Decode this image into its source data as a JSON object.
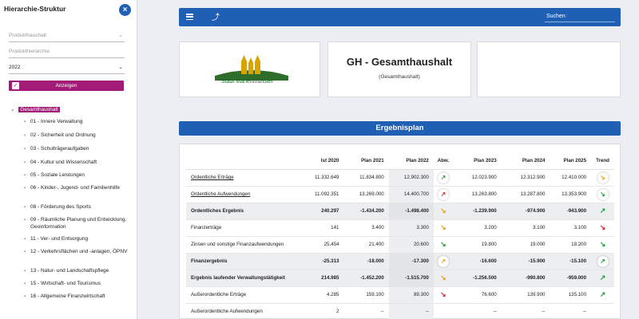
{
  "sidebar": {
    "title": "Hierarchie-Struktur",
    "close_icon": "×",
    "field1_placeholder": "Produkthaushalt",
    "field2_placeholder": "Produkthierarchie",
    "year": "2022",
    "button_label": "Anzeigen",
    "root_label": "Gesamthaushalt",
    "items": [
      {
        "label": "01 - Innere Verwaltung"
      },
      {
        "label": "02 - Sicherheit und Ordnung"
      },
      {
        "label": "03 - Schulträgeraufgaben"
      },
      {
        "label": "04 - Kultur und Wissenschaft"
      },
      {
        "label": "05 - Soziale Leistungen"
      },
      {
        "label": "06 - Kinder-, Jugend- und Familienhilfe"
      },
      {
        "label": "08 - Förderung des Sports"
      },
      {
        "label": "09 - Räumliche Planung und Entwicklung, Geoinformation"
      },
      {
        "label": "11 - Ver- und Entsorgung"
      },
      {
        "label": "12 - Verkehrsflächen und -anlagen, ÖPNV"
      },
      {
        "label": "13 - Natur- und Landschaftspflege"
      },
      {
        "label": "15 - Wirtschaft- und Tourismus"
      },
      {
        "label": "16 - Allgemeine Finanzwirtschaft"
      }
    ]
  },
  "topbar": {
    "search_label": "Suchen",
    "up_icon": "⤴"
  },
  "cards": {
    "logo_text": "Stadt Marienmünster",
    "title": "GH - Gesamthaushalt",
    "subtitle": "(Gesamthaushalt)"
  },
  "plan": {
    "header": "Ergebnisplan",
    "columns": [
      "",
      "Ist 2020",
      "Plan 2021",
      "Plan 2022",
      "Abw.",
      "Plan 2023",
      "Plan 2024",
      "Plan 2025",
      "Trend"
    ],
    "rows": [
      {
        "label": "Ordentliche Erträge",
        "ist2020": "11.332.649",
        "p2021": "11.834.800",
        "p2022": "12.902.300",
        "abw": "↗",
        "abw_color": "green",
        "abw_circle": true,
        "p2023": "12.023.900",
        "p2024": "12.312.900",
        "p2025": "12.410.000",
        "trend": "↘",
        "trend_color": "orange",
        "trend_circle": true,
        "underline": true,
        "shaded": false
      },
      {
        "label": "Ordentliche Aufwendungen",
        "ist2020": "11.092.351",
        "p2021": "13.269.000",
        "p2022": "14.400.700",
        "abw": "↗",
        "abw_color": "red",
        "abw_circle": true,
        "p2023": "13.263.800",
        "p2024": "13.287.800",
        "p2025": "13.353.900",
        "trend": "↘",
        "trend_color": "green",
        "trend_circle": true,
        "underline": true,
        "shaded": false
      },
      {
        "label": "Ordentliches Ergebnis",
        "ist2020": "240.297",
        "p2021": "-1.434.200",
        "p2022": "-1.498.400",
        "abw": "↘",
        "abw_color": "orange",
        "abw_circle": false,
        "p2023": "-1.239.900",
        "p2024": "-974.900",
        "p2025": "-943.900",
        "trend": "↗",
        "trend_color": "green",
        "trend_circle": false,
        "underline": false,
        "shaded": true
      },
      {
        "label": "Finanzerträge",
        "ist2020": "141",
        "p2021": "3.400",
        "p2022": "3.300",
        "abw": "↘",
        "abw_color": "orange",
        "abw_circle": false,
        "p2023": "3.200",
        "p2024": "3.100",
        "p2025": "3.100",
        "trend": "↘",
        "trend_color": "red",
        "trend_circle": false,
        "underline": false,
        "shaded": false
      },
      {
        "label": "Zinsen und sonstige Finanzaufwendungen",
        "ist2020": "25.454",
        "p2021": "21.400",
        "p2022": "20.600",
        "abw": "↘",
        "abw_color": "green",
        "abw_circle": false,
        "p2023": "19.800",
        "p2024": "19.000",
        "p2025": "18.200",
        "trend": "↘",
        "trend_color": "green",
        "trend_circle": false,
        "underline": false,
        "shaded": false
      },
      {
        "label": "Finanzergebnis",
        "ist2020": "-25.313",
        "p2021": "-18.000",
        "p2022": "-17.300",
        "abw": "↗",
        "abw_color": "orange",
        "abw_circle": true,
        "p2023": "-16.600",
        "p2024": "-15.900",
        "p2025": "-15.100",
        "trend": "↗",
        "trend_color": "green",
        "trend_circle": true,
        "underline": false,
        "shaded": true
      },
      {
        "label": "Ergebnis laufender Verwaltungstätigkeit",
        "ist2020": "214.985",
        "p2021": "-1.452.200",
        "p2022": "-1.515.700",
        "abw": "↘",
        "abw_color": "orange",
        "abw_circle": false,
        "p2023": "-1.256.500",
        "p2024": "-990.800",
        "p2025": "-959.000",
        "trend": "↗",
        "trend_color": "green",
        "trend_circle": false,
        "underline": false,
        "shaded": true
      },
      {
        "label": "Außerordentliche Erträge",
        "ist2020": "4.285",
        "p2021": "159.100",
        "p2022": "89.300",
        "abw": "↘",
        "abw_color": "red",
        "abw_circle": false,
        "p2023": "76.600",
        "p2024": "139.900",
        "p2025": "135.100",
        "trend": "↗",
        "trend_color": "green",
        "trend_circle": false,
        "underline": false,
        "shaded": false
      },
      {
        "label": "Außerordentliche Aufwendungen",
        "ist2020": "2",
        "p2021": "--",
        "p2022": "--",
        "abw": "",
        "abw_color": "",
        "abw_circle": false,
        "p2023": "--",
        "p2024": "--",
        "p2025": "--",
        "trend": "",
        "trend_color": "",
        "trend_circle": false,
        "underline": false,
        "shaded": false
      }
    ]
  },
  "colors": {
    "primary": "#1f5fb4",
    "accent": "#a21c77",
    "green": "#1f9d3a",
    "red": "#c62828",
    "orange": "#f59b12"
  }
}
